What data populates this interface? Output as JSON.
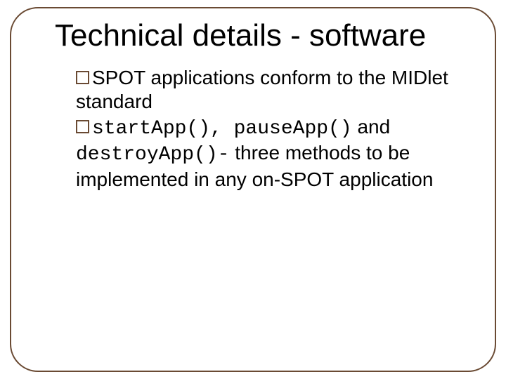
{
  "title": "Technical details - software",
  "p1a": "SPOT applications conform to the MIDlet standard",
  "code1": "startApp(), pauseApp()",
  "p2a": " and ",
  "code2": "destroyApp()-",
  "p2b": " three methods to be implemented in any on-SPOT application"
}
